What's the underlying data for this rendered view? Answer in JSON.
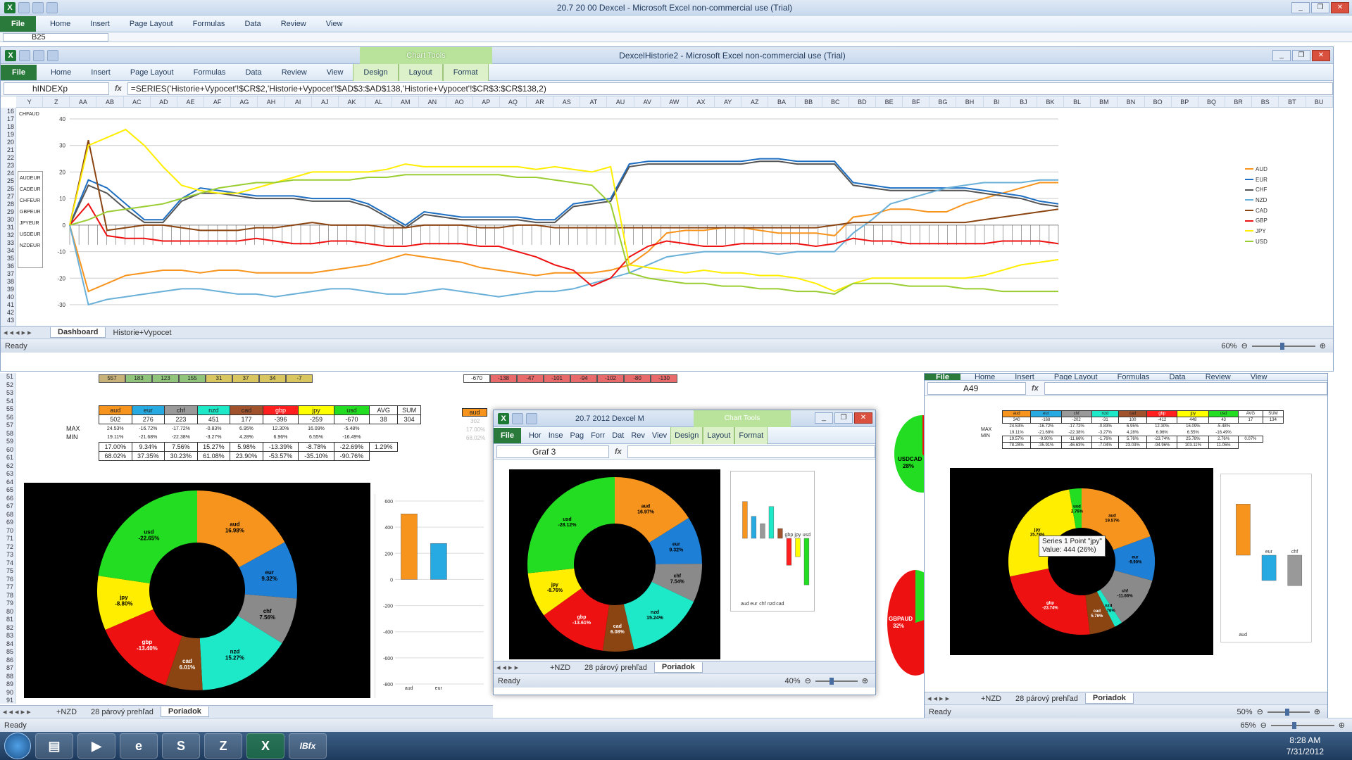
{
  "back_window": {
    "title": "20.7 20 00 Dexcel  -  Microsoft Excel non-commercial use (Trial)",
    "tabs": [
      "File",
      "Home",
      "Insert",
      "Page Layout",
      "Formulas",
      "Data",
      "Review",
      "View"
    ],
    "name_box": "B25"
  },
  "front_window": {
    "title": "DexcelHistorie2  -  Microsoft Excel non-commercial use (Trial)",
    "chart_tools_label": "Chart Tools",
    "tabs": [
      "File",
      "Home",
      "Insert",
      "Page Layout",
      "Formulas",
      "Data",
      "Review",
      "View",
      "Design",
      "Layout",
      "Format"
    ],
    "name_box": "hINDEXp",
    "formula": "=SERIES('Historie+Vypocet'!$CR$2,'Historie+Vypocet'!$AD$3:$AD$138,'Historie+Vypocet'!$CR$3:$CR$138,2)",
    "columns": [
      "Y",
      "Z",
      "AA",
      "AB",
      "AC",
      "AD",
      "AE",
      "AF",
      "AG",
      "AH",
      "AI",
      "AJ",
      "AK",
      "AL",
      "AM",
      "AN",
      "AO",
      "AP",
      "AQ",
      "AR",
      "AS",
      "AT",
      "AU",
      "AV",
      "AW",
      "AX",
      "AY",
      "AZ",
      "BA",
      "BB",
      "BC",
      "BD",
      "BE",
      "BF",
      "BG",
      "BH",
      "BI",
      "BJ",
      "BK",
      "BL",
      "BM",
      "BN",
      "BO",
      "BP",
      "BQ",
      "BR",
      "BS",
      "BT",
      "BU"
    ],
    "rows": [
      "16",
      "17",
      "18",
      "19",
      "20",
      "21",
      "22",
      "23",
      "24",
      "25",
      "26",
      "27",
      "28",
      "29",
      "30",
      "31",
      "32",
      "33",
      "34",
      "35",
      "36",
      "37",
      "38",
      "39",
      "40",
      "41",
      "42",
      "43"
    ],
    "sheet_tabs": [
      "Dashboard",
      "Historie+Vypocet"
    ],
    "status": "Ready",
    "zoom": "60%"
  },
  "left_small_legend": [
    "CHFAUD",
    "AUDEUR",
    "CADEUR",
    "CHFEUR",
    "GBPEUR",
    "JPYEUR",
    "USDEUR",
    "NZDEUR"
  ],
  "bottom_sheet": {
    "sum_row": {
      "label_left": [
        "557",
        "183",
        "123",
        "155",
        "31",
        "37",
        "34",
        "-7"
      ],
      "label_right": [
        "-670",
        "-138",
        "-47",
        "-101",
        "-94",
        "-102",
        "-80",
        "-130"
      ]
    },
    "headers": [
      "aud",
      "eur",
      "chf",
      "nzd",
      "cad",
      "gbp",
      "jpy",
      "usd",
      "AVG",
      "SUM"
    ],
    "header_colors": [
      "#f7941d",
      "#27aae1",
      "#999999",
      "#1de9c9",
      "#a0522d",
      "#ff1f1f",
      "#ffff00",
      "#22dd22"
    ],
    "row_values": [
      "502",
      "276",
      "223",
      "451",
      "177",
      "-396",
      "-259",
      "-670",
      "38",
      "304"
    ],
    "max_label": "MAX",
    "min_label": "MIN",
    "max_values": [
      "24.53%",
      "-16.72%",
      "-17.72%",
      "-0.83%",
      "6.95%",
      "12.30%",
      "16.09%",
      "-5.48%"
    ],
    "min_values": [
      "19.11%",
      "-21.68%",
      "-22.38%",
      "-3.27%",
      "4.28%",
      "6.96%",
      "6.55%",
      "-16.49%"
    ],
    "pct_values": [
      "17.00%",
      "9.34%",
      "7.56%",
      "15.27%",
      "5.98%",
      "-13.39%",
      "-8.78%",
      "-22.69%",
      "1.29%"
    ],
    "pct2_values": [
      "68.02%",
      "37.35%",
      "30.23%",
      "61.08%",
      "23.90%",
      "-53.57%",
      "-35.10%",
      "-90.76%"
    ],
    "row_numbers": [
      "51",
      "52",
      "53",
      "54",
      "55",
      "56",
      "57",
      "58",
      "59",
      "60",
      "61",
      "62",
      "63",
      "64",
      "65",
      "66",
      "67",
      "68",
      "69",
      "70",
      "71",
      "72",
      "73",
      "74",
      "75",
      "76",
      "77",
      "78",
      "79",
      "80",
      "81",
      "82",
      "83",
      "84",
      "85",
      "86",
      "87",
      "88",
      "89",
      "90",
      "91"
    ],
    "right_partial": [
      "aud",
      "302",
      "17.00%",
      "68.02%"
    ],
    "status": "Ready",
    "sheet_tabs": [
      "+NZD",
      "28 párový prehľad",
      "Poriadok"
    ],
    "zoom": "65%"
  },
  "main_donut": {
    "slices": [
      {
        "name": "aud",
        "value": "16.98%",
        "color": "#f7941d",
        "w": 16.98
      },
      {
        "name": "eur",
        "value": "9.32%",
        "color": "#1e7fd6",
        "w": 9.32
      },
      {
        "name": "chf",
        "value": "7.56%",
        "color": "#8a8a8a",
        "w": 7.56
      },
      {
        "name": "nzd",
        "value": "15.27%",
        "color": "#1de9c9",
        "w": 15.27
      },
      {
        "name": "cad",
        "value": "6.01%",
        "color": "#8b4513",
        "w": 6.01
      },
      {
        "name": "gbp",
        "value": "-13.40%",
        "color": "#ee1111",
        "w": 13.4
      },
      {
        "name": "jpy",
        "value": "-8.80%",
        "color": "#ffee00",
        "w": 8.8
      },
      {
        "name": "usd",
        "value": "-22.65%",
        "color": "#22dd22",
        "w": 22.65
      }
    ]
  },
  "main_bar": {
    "yticks": [
      "600",
      "400",
      "200",
      "0",
      "-200",
      "-400",
      "-600",
      "-800"
    ],
    "categories": [
      "aud",
      "eur"
    ],
    "values": [
      502,
      276
    ],
    "colors": [
      "#f7941d",
      "#27aae1"
    ],
    "ylim": [
      -800,
      600
    ]
  },
  "middle_window": {
    "title": "20.7 2012 Dexcel M",
    "chart_tools_label": "Chart Tools",
    "tabs": [
      "File",
      "Hor",
      "Inse",
      "Pag",
      "Forr",
      "Dat",
      "Rev",
      "Viev",
      "Design",
      "Layout",
      "Format"
    ],
    "name_box": "Graf 3",
    "sheet_tabs": [
      "+NZD",
      "28 párový prehľad",
      "Poriadok"
    ],
    "status": "Ready",
    "zoom": "40%",
    "donut": [
      {
        "name": "aud",
        "value": "16.97%",
        "color": "#f7941d",
        "w": 16.97
      },
      {
        "name": "eur",
        "value": "9.32%",
        "color": "#1e7fd6",
        "w": 9.32
      },
      {
        "name": "chf",
        "value": "7.54%",
        "color": "#8a8a8a",
        "w": 7.54
      },
      {
        "name": "nzd",
        "value": "15.24%",
        "color": "#1de9c9",
        "w": 15.24
      },
      {
        "name": "cad",
        "value": "6.08%",
        "color": "#8b4513",
        "w": 6.08
      },
      {
        "name": "gbp",
        "value": "-13.61%",
        "color": "#ee1111",
        "w": 13.61
      },
      {
        "name": "jpy",
        "value": "-8.76%",
        "color": "#ffee00",
        "w": 8.76
      },
      {
        "name": "usd",
        "value": "-28.12%",
        "color": "#22dd22",
        "w": 28.12
      }
    ],
    "bar_categories": [
      "aud",
      "eur",
      "chf",
      "nzd",
      "cad",
      "gbp",
      "jpy",
      "usd"
    ],
    "bar_values": [
      300,
      180,
      120,
      260,
      80,
      -220,
      -150,
      -380
    ],
    "bar_colors": [
      "#f7941d",
      "#27aae1",
      "#999999",
      "#1de9c9",
      "#a0522d",
      "#ff1f1f",
      "#ffff00",
      "#22dd22"
    ]
  },
  "right_window": {
    "tabs": [
      "File",
      "Home",
      "Insert",
      "Page Layout",
      "Formulas",
      "Data",
      "Review",
      "View"
    ],
    "name_box": "A49",
    "headers": [
      "aud",
      "eur",
      "chf",
      "nzd",
      "cad",
      "gbp",
      "jpy",
      "usd",
      "AVG",
      "SUM"
    ],
    "row_values": [
      "340",
      "-168",
      "-202",
      "-31",
      "100",
      "-412",
      "448",
      "43",
      "17",
      "134"
    ],
    "max_label": "MAX",
    "min_label": "MIN",
    "max_values": [
      "24.53%",
      "-16.72%",
      "-17.72%",
      "-0.83%",
      "6.95%",
      "12.30%",
      "16.09%",
      "-5.48%"
    ],
    "min_values": [
      "19.11%",
      "-21.68%",
      "-22.38%",
      "-3.27%",
      "4.28%",
      "6.96%",
      "6.55%",
      "-16.49%"
    ],
    "pct_values": [
      "19.57%",
      "-9.90%",
      "-11.66%",
      "-1.76%",
      "5.76%",
      "-23.74%",
      "25.78%",
      "2.76%",
      "0.07%"
    ],
    "pct2_values": [
      "78.28%",
      "-35.91%",
      "-46.63%",
      "-7.04%",
      "23.03%",
      "-94.96%",
      "103.11%",
      "11.05%"
    ],
    "tooltip_line1": "Series 1 Point \"jpy\"",
    "tooltip_line2": "Value: 444 (26%)",
    "donut": [
      {
        "name": "aud",
        "value": "19.57%",
        "color": "#f7941d",
        "w": 19.57
      },
      {
        "name": "eur",
        "value": "-9.90%",
        "color": "#1e7fd6",
        "w": 9.9
      },
      {
        "name": "chf",
        "value": "-11.66%",
        "color": "#8a8a8a",
        "w": 11.66
      },
      {
        "name": "nzd",
        "value": "-1.76%",
        "color": "#1de9c9",
        "w": 1.76
      },
      {
        "name": "cad",
        "value": "5.76%",
        "color": "#8b4513",
        "w": 5.76
      },
      {
        "name": "gbp",
        "value": "-23.74%",
        "color": "#ee1111",
        "w": 23.74
      },
      {
        "name": "jpy",
        "value": "25.78%",
        "color": "#ffee00",
        "w": 25.78
      },
      {
        "name": "usd",
        "value": "2.76%",
        "color": "#22dd22",
        "w": 2.76
      }
    ],
    "bar_categories": [
      "aud",
      "eur",
      "chf"
    ],
    "bar_values": [
      340,
      -168,
      -202
    ],
    "bar_colors": [
      "#f7941d",
      "#27aae1",
      "#999999"
    ],
    "sheet_tabs": [
      "+NZD",
      "28 párový prehľad",
      "Poriadok"
    ],
    "status": "Ready",
    "zoom": "50%"
  },
  "side_labels": {
    "usdcad": "USDCAD",
    "usdcad_pct": "28%",
    "gbpaud": "GBPAUD",
    "gbpaud_pct": "32%"
  },
  "chart_data": {
    "type": "line",
    "title": "",
    "ylim": [
      -30,
      40
    ],
    "yticks": [
      40,
      30,
      20,
      10,
      0,
      -10,
      -20,
      -30
    ],
    "legend": [
      "AUD",
      "EUR",
      "CHF",
      "NZD",
      "CAD",
      "GBP",
      "JPY",
      "USD"
    ],
    "legend_placement": "right",
    "grid": true,
    "series": [
      {
        "name": "AUD",
        "color": "#f7941d",
        "values": [
          0,
          -25,
          -22,
          -19,
          -18,
          -17,
          -17,
          -18,
          -17,
          -17,
          -18,
          -18,
          -18,
          -18,
          -17,
          -16,
          -15,
          -13,
          -11,
          -12,
          -13,
          -14,
          -16,
          -17,
          -18,
          -19,
          -18,
          -18,
          -18,
          -17,
          -15,
          -10,
          -3,
          -2,
          -2,
          -1,
          -1,
          -2,
          -3,
          -3,
          -3,
          -4,
          3,
          4,
          6,
          6,
          5,
          5,
          8,
          10,
          12,
          14,
          16,
          16
        ]
      },
      {
        "name": "EUR",
        "color": "#1e6fc2",
        "values": [
          0,
          17,
          14,
          8,
          2,
          2,
          10,
          14,
          13,
          12,
          11,
          11,
          11,
          10,
          10,
          10,
          8,
          4,
          0,
          5,
          4,
          3,
          3,
          3,
          3,
          2,
          2,
          8,
          9,
          10,
          23,
          24,
          24,
          24,
          24,
          24,
          24,
          25,
          25,
          24,
          24,
          24,
          16,
          15,
          14,
          14,
          14,
          14,
          14,
          13,
          12,
          11,
          9,
          8
        ]
      },
      {
        "name": "CHF",
        "color": "#555555",
        "values": [
          0,
          15,
          12,
          6,
          1,
          1,
          9,
          12,
          12,
          11,
          10,
          10,
          10,
          9,
          9,
          9,
          7,
          3,
          -1,
          4,
          3,
          2,
          2,
          2,
          2,
          1,
          1,
          7,
          8,
          9,
          22,
          23,
          23,
          23,
          23,
          23,
          23,
          24,
          24,
          23,
          23,
          23,
          15,
          14,
          13,
          13,
          13,
          13,
          13,
          12,
          11,
          10,
          8,
          7
        ]
      },
      {
        "name": "NZD",
        "color": "#6ab0d8",
        "values": [
          0,
          -30,
          -28,
          -27,
          -26,
          -25,
          -24,
          -24,
          -25,
          -26,
          -26,
          -27,
          -26,
          -25,
          -24,
          -24,
          -25,
          -26,
          -26,
          -25,
          -24,
          -25,
          -26,
          -27,
          -26,
          -25,
          -25,
          -24,
          -22,
          -20,
          -18,
          -15,
          -12,
          -11,
          -10,
          -10,
          -10,
          -10,
          -11,
          -10,
          -10,
          -10,
          -3,
          2,
          8,
          10,
          12,
          14,
          15,
          16,
          16,
          16,
          17,
          17
        ]
      },
      {
        "name": "CAD",
        "color": "#8b4513",
        "values": [
          0,
          32,
          -2,
          -1,
          0,
          0,
          -1,
          -2,
          -2,
          -2,
          -1,
          -1,
          0,
          1,
          0,
          0,
          0,
          -1,
          -1,
          0,
          0,
          0,
          -1,
          -1,
          0,
          0,
          -1,
          -1,
          -1,
          -1,
          -1,
          -1,
          -1,
          -1,
          -1,
          -1,
          -1,
          -1,
          -1,
          -1,
          -1,
          0,
          1,
          1,
          1,
          1,
          1,
          1,
          1,
          2,
          3,
          4,
          5,
          6
        ]
      },
      {
        "name": "GBP",
        "color": "#ee1111",
        "values": [
          0,
          8,
          -4,
          -5,
          -5,
          -6,
          -6,
          -6,
          -6,
          -6,
          -5,
          -6,
          -7,
          -7,
          -6,
          -6,
          -7,
          -8,
          -8,
          -7,
          -7,
          -7,
          -8,
          -8,
          -10,
          -12,
          -15,
          -17,
          -23,
          -20,
          -12,
          -8,
          -6,
          -7,
          -8,
          -8,
          -7,
          -7,
          -7,
          -7,
          -8,
          -7,
          -5,
          -6,
          -6,
          -7,
          -7,
          -7,
          -7,
          -7,
          -6,
          -6,
          -6,
          -7
        ]
      },
      {
        "name": "JPY",
        "color": "#ffee00",
        "values": [
          0,
          30,
          33,
          36,
          30,
          22,
          15,
          13,
          12,
          12,
          14,
          16,
          18,
          20,
          20,
          20,
          20,
          21,
          23,
          22,
          22,
          22,
          22,
          22,
          22,
          21,
          22,
          21,
          20,
          22,
          -15,
          -16,
          -17,
          -18,
          -17,
          -18,
          -18,
          -19,
          -19,
          -20,
          -22,
          -25,
          -22,
          -20,
          -20,
          -20,
          -20,
          -20,
          -20,
          -19,
          -17,
          -15,
          -14,
          -13
        ]
      },
      {
        "name": "USD",
        "color": "#9acd32",
        "values": [
          0,
          2,
          5,
          6,
          7,
          8,
          10,
          12,
          14,
          15,
          16,
          16,
          17,
          17,
          17,
          17,
          18,
          18,
          19,
          19,
          19,
          19,
          19,
          19,
          18,
          18,
          17,
          16,
          15,
          8,
          -18,
          -20,
          -21,
          -22,
          -22,
          -23,
          -23,
          -24,
          -24,
          -25,
          -25,
          -26,
          -22,
          -22,
          -22,
          -23,
          -23,
          -23,
          -24,
          -24,
          -25,
          -25,
          -25,
          -25
        ]
      }
    ]
  },
  "taskbar": {
    "time": "8:28 AM",
    "date": "7/31/2012",
    "apps": [
      "explorer",
      "media-player",
      "internet-explorer",
      "skype",
      "z-app",
      "excel",
      "ib-app"
    ],
    "ib_label": "IBfx"
  }
}
